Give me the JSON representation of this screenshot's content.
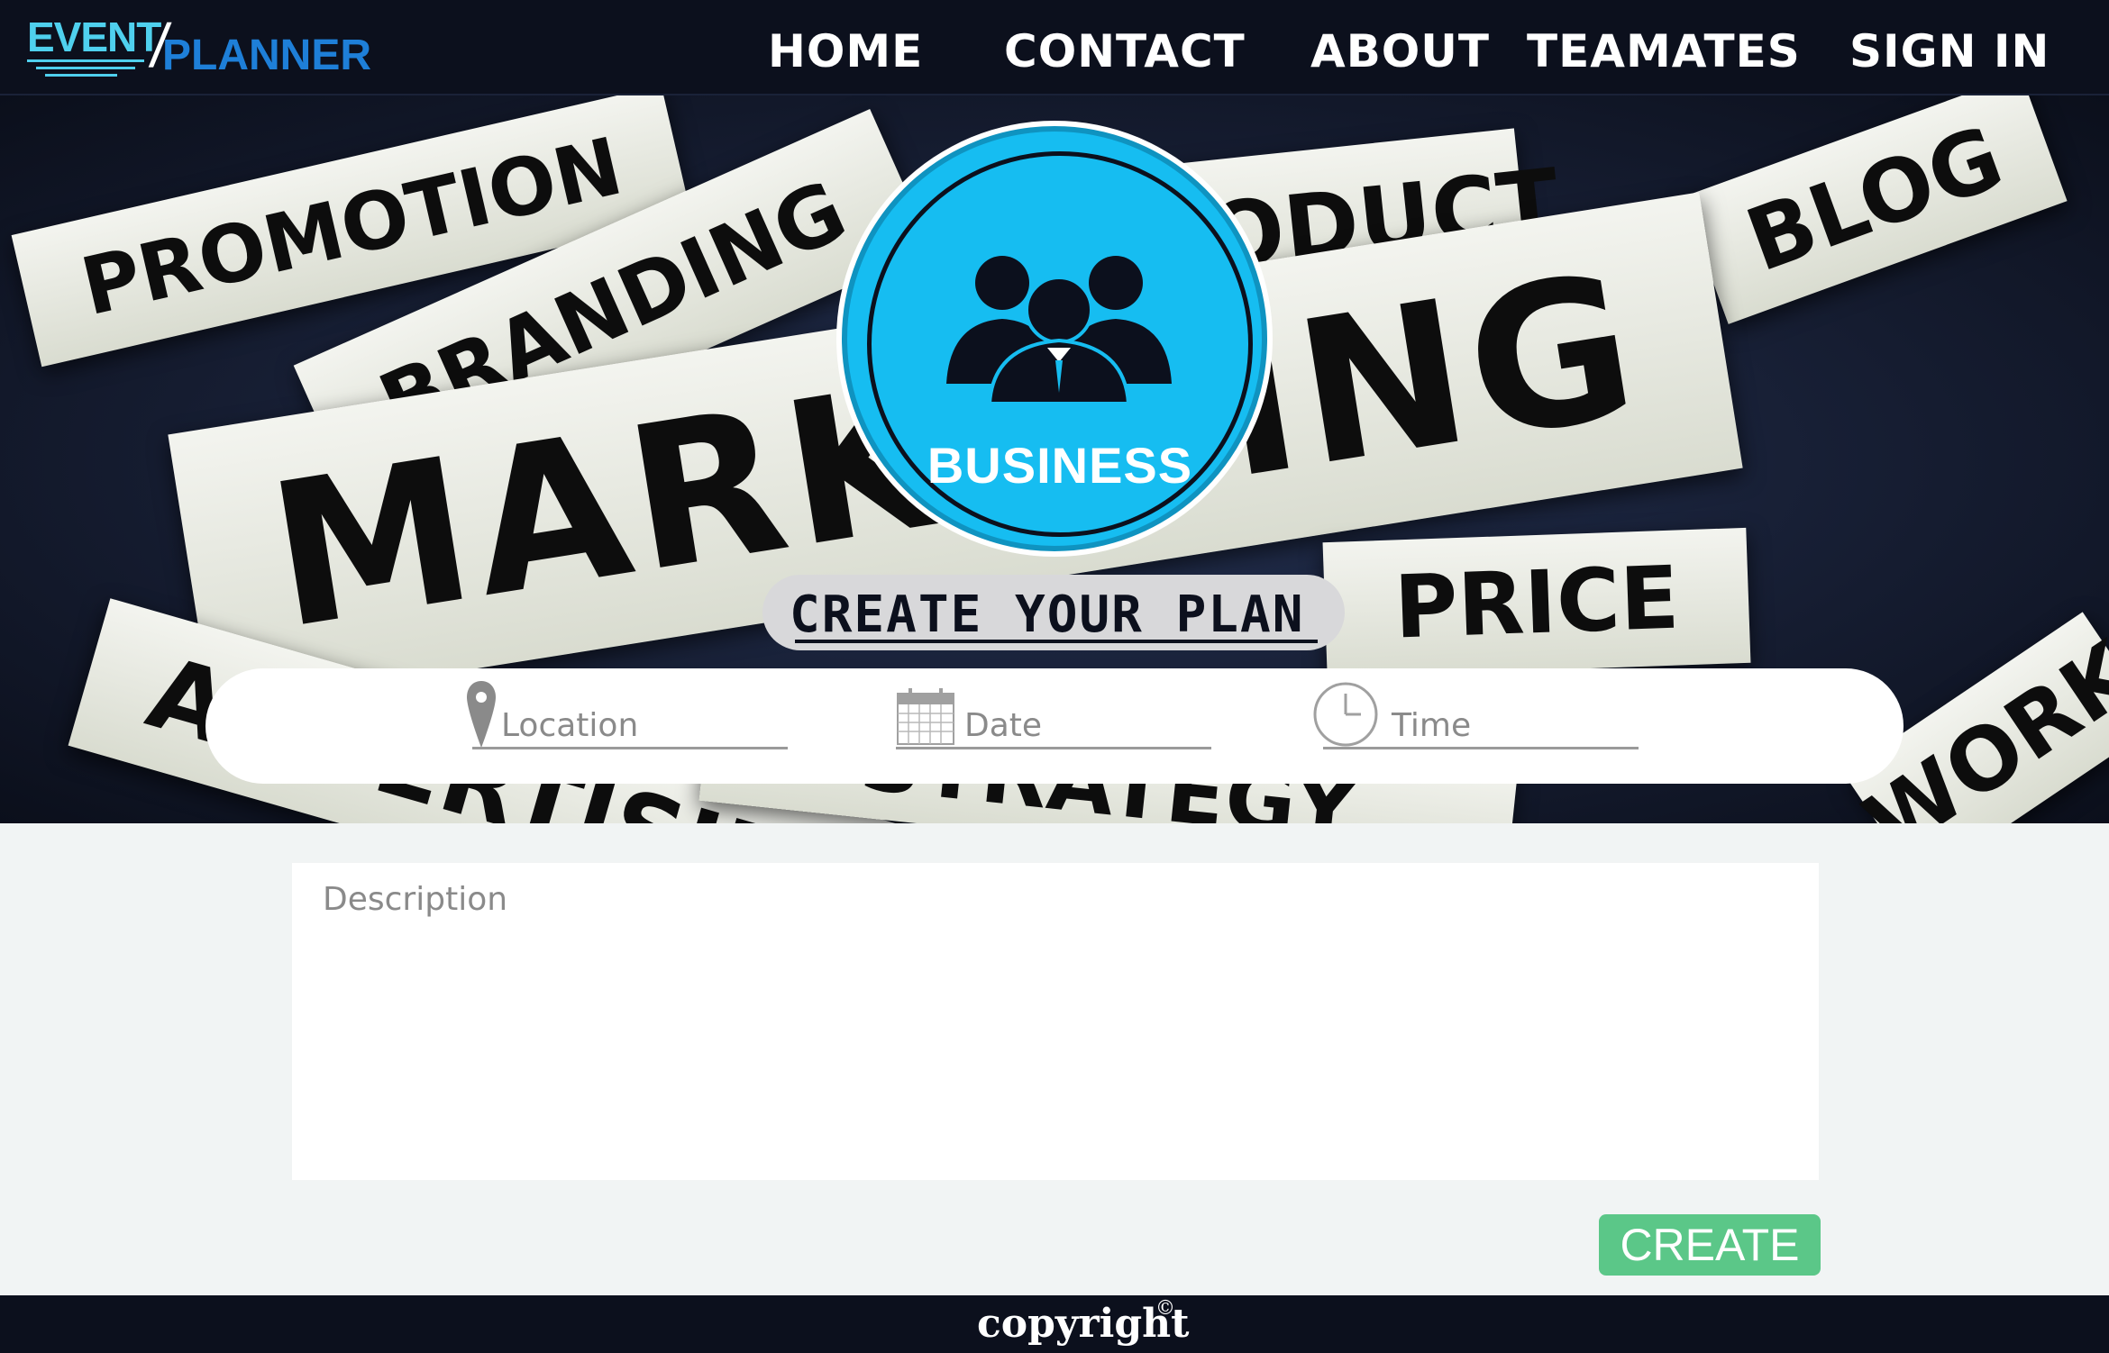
{
  "navbar": {
    "logo": {
      "event": "EVENT",
      "slash": "/",
      "planner": "PLANNER"
    },
    "links": [
      "HOME",
      "CONTACT",
      "ABOUT",
      "TEAMATES",
      "SIGN IN"
    ]
  },
  "hero": {
    "background_words": [
      "PROMOTION",
      "BRANDING",
      "PRODUCT",
      "BLOG",
      "MARKETING",
      "PRICE",
      "ADVERTISING",
      "STRATEGY",
      "WORK"
    ],
    "badge": {
      "label": "BUSINESS",
      "icon": "business-people-icon"
    },
    "plan_title": "CREATE YOUR PLAN"
  },
  "search": {
    "location": {
      "placeholder": "Location",
      "icon": "location-pin-icon"
    },
    "date": {
      "placeholder": "Date",
      "icon": "calendar-icon"
    },
    "time": {
      "placeholder": "Time",
      "icon": "clock-icon"
    }
  },
  "form": {
    "description_placeholder": "Description",
    "create_label": "CREATE"
  },
  "footer": {
    "copyright": "copyright",
    "copy_mark": "©"
  },
  "colors": {
    "navbar": "#0c101d",
    "logo_event": "#4fd0ee",
    "logo_planner": "#1e7fd8",
    "badge": "#16bdf1",
    "create_button": "#5bc788",
    "page_bg": "#f1f4f4"
  }
}
